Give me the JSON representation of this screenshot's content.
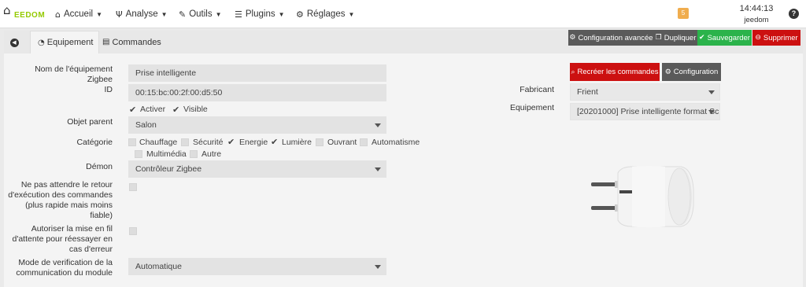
{
  "navbar": {
    "logo_text": "EEDOM",
    "menus": [
      {
        "label": "Accueil",
        "icon": "home-icon"
      },
      {
        "label": "Analyse",
        "icon": "stethoscope-icon"
      },
      {
        "label": "Outils",
        "icon": "wrench-icon"
      },
      {
        "label": "Plugins",
        "icon": "tasks-icon"
      },
      {
        "label": "Réglages",
        "icon": "cogs-icon"
      }
    ],
    "notification_count": "5",
    "time": "14:44:13",
    "user": "jeedom"
  },
  "tabs": {
    "equipment": "Equipement",
    "commands": "Commandes"
  },
  "actions": {
    "advanced_config": "Configuration avancée",
    "duplicate": "Dupliquer",
    "save": "Sauvegarder",
    "delete": "Supprimer",
    "recreate_commands": "Recréer les commandes",
    "configuration": "Configuration"
  },
  "form": {
    "name_label": "Nom de l'équipement Zigbee",
    "name_value": "Prise intelligente",
    "id_label": "ID",
    "id_value": "00:15:bc:00:2f:00:d5:50",
    "activate_label": "Activer",
    "visible_label": "Visible",
    "parent_label": "Objet parent",
    "parent_value": "Salon",
    "category_label": "Catégorie",
    "categories": [
      {
        "label": "Chauffage",
        "checked": false
      },
      {
        "label": "Sécurité",
        "checked": false
      },
      {
        "label": "Energie",
        "checked": true
      },
      {
        "label": "Lumière",
        "checked": true
      },
      {
        "label": "Ouvrant",
        "checked": false
      },
      {
        "label": "Automatisme",
        "checked": false
      },
      {
        "label": "Multimédia",
        "checked": false
      },
      {
        "label": "Autre",
        "checked": false
      }
    ],
    "daemon_label": "Démon",
    "daemon_value": "Contrôleur Zigbee",
    "noack_label_1": "Ne pas attendre le retour",
    "noack_label_2": "d'exécution des commandes",
    "noack_label_3": "(plus rapide mais moins",
    "noack_label_4": "fiable)",
    "retry_label_1": "Autoriser la mise en fil",
    "retry_label_2": "d'attente pour réessayer en",
    "retry_label_3": "cas d'erreur",
    "verif_label_1": "Mode de verification de la",
    "verif_label_2": "communication du module",
    "verif_value": "Automatique",
    "manufacturer_label": "Fabricant",
    "manufacturer_value": "Frient",
    "equipment_label": "Equipement",
    "equipment_value": "[20201000] Prise intelligente format Sc"
  },
  "colors": {
    "dark_button": "#5a5a5a",
    "save_green": "#2bb34b",
    "delete_red": "#cc1010",
    "logo_green": "#94ca02",
    "badge_orange": "#f0ad4e"
  }
}
